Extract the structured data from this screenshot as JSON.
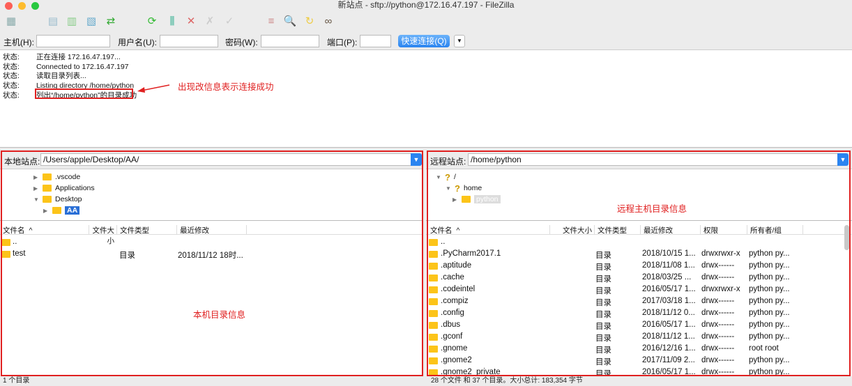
{
  "window": {
    "title": "新站点 - sftp://python@172.16.47.197 - FileZilla"
  },
  "toolbar": {
    "icons": [
      "site-manager-icon",
      "message-log-icon",
      "local-tree-icon",
      "remote-tree-icon",
      "transfer-queue-icon",
      "refresh-icon",
      "filter-icon",
      "cancel-icon",
      "disconnect-icon",
      "reconnect-icon",
      "compare-icon",
      "search-files-icon",
      "sync-browse-icon",
      "find-icon"
    ]
  },
  "quickconnect": {
    "host_label": "主机(H):",
    "host_value": "",
    "user_label": "用户名(U):",
    "user_value": "",
    "pass_label": "密码(W):",
    "pass_value": "",
    "port_label": "端口(P):",
    "port_value": "",
    "button": "快速连接(Q)",
    "dropdown": "▼"
  },
  "log": [
    {
      "key": "状态:",
      "msg": "正在连接 172.16.47.197..."
    },
    {
      "key": "状态:",
      "msg": "Connected to 172.16.47.197"
    },
    {
      "key": "状态:",
      "msg": "读取目录列表..."
    },
    {
      "key": "状态:",
      "msg": "Listing directory /home/python"
    },
    {
      "key": "状态:",
      "msg": "列出“/home/python”的目录成功"
    }
  ],
  "annotations": {
    "log": "出现改信息表示连接成功",
    "local": "本机目录信息",
    "remote": "远程主机目录信息"
  },
  "local": {
    "label": "本地站点:",
    "path": "/Users/apple/Desktop/AA/",
    "tree": [
      {
        "name": ".vscode",
        "expanded": false
      },
      {
        "name": "Applications",
        "expanded": false
      },
      {
        "name": "Desktop",
        "expanded": true
      },
      {
        "name": "AA",
        "selected": true
      }
    ],
    "columns": [
      "文件名",
      "文件大小",
      "文件类型",
      "最近修改"
    ],
    "rows": [
      {
        "name": "..",
        "size": "",
        "type": "",
        "modified": ""
      },
      {
        "name": "test",
        "size": "",
        "type": "目录",
        "modified": "2018/11/12 18时..."
      }
    ],
    "status": "1 个目录"
  },
  "remote": {
    "label": "远程站点:",
    "path": "/home/python",
    "tree": [
      {
        "name": "/",
        "expanded": true
      },
      {
        "name": "home",
        "expanded": true
      },
      {
        "name": "python",
        "selected": true
      }
    ],
    "columns": [
      "文件名",
      "文件大小",
      "文件类型",
      "最近修改",
      "权限",
      "所有者/组"
    ],
    "rows": [
      {
        "name": "..",
        "type": "",
        "modified": "",
        "perm": "",
        "owner": ""
      },
      {
        "name": ".PyCharm2017.1",
        "type": "目录",
        "modified": "2018/10/15 1...",
        "perm": "drwxrwxr-x",
        "owner": "python py..."
      },
      {
        "name": ".aptitude",
        "type": "目录",
        "modified": "2018/11/08 1...",
        "perm": "drwx------",
        "owner": "python py..."
      },
      {
        "name": ".cache",
        "type": "目录",
        "modified": "2018/03/25 ...",
        "perm": "drwx------",
        "owner": "python py..."
      },
      {
        "name": ".codeintel",
        "type": "目录",
        "modified": "2016/05/17 1...",
        "perm": "drwxrwxr-x",
        "owner": "python py..."
      },
      {
        "name": ".compiz",
        "type": "目录",
        "modified": "2017/03/18 1...",
        "perm": "drwx------",
        "owner": "python py..."
      },
      {
        "name": ".config",
        "type": "目录",
        "modified": "2018/11/12 0...",
        "perm": "drwx------",
        "owner": "python py..."
      },
      {
        "name": ".dbus",
        "type": "目录",
        "modified": "2016/05/17 1...",
        "perm": "drwx------",
        "owner": "python py..."
      },
      {
        "name": ".gconf",
        "type": "目录",
        "modified": "2018/11/12 1...",
        "perm": "drwx------",
        "owner": "python py..."
      },
      {
        "name": ".gnome",
        "type": "目录",
        "modified": "2016/12/16 1...",
        "perm": "drwx------",
        "owner": "root root"
      },
      {
        "name": ".gnome2",
        "type": "目录",
        "modified": "2017/11/09 2...",
        "perm": "drwx------",
        "owner": "python py..."
      },
      {
        "name": ".gnome2_private",
        "type": "目录",
        "modified": "2016/05/17 1...",
        "perm": "drwx------",
        "owner": "python py..."
      }
    ],
    "status": "28 个文件 和 37 个目录。大小总计: 183,354 字节"
  },
  "colors": {
    "accent": "#2a84f0",
    "annotation": "#e02020",
    "folder": "#fcc419"
  }
}
